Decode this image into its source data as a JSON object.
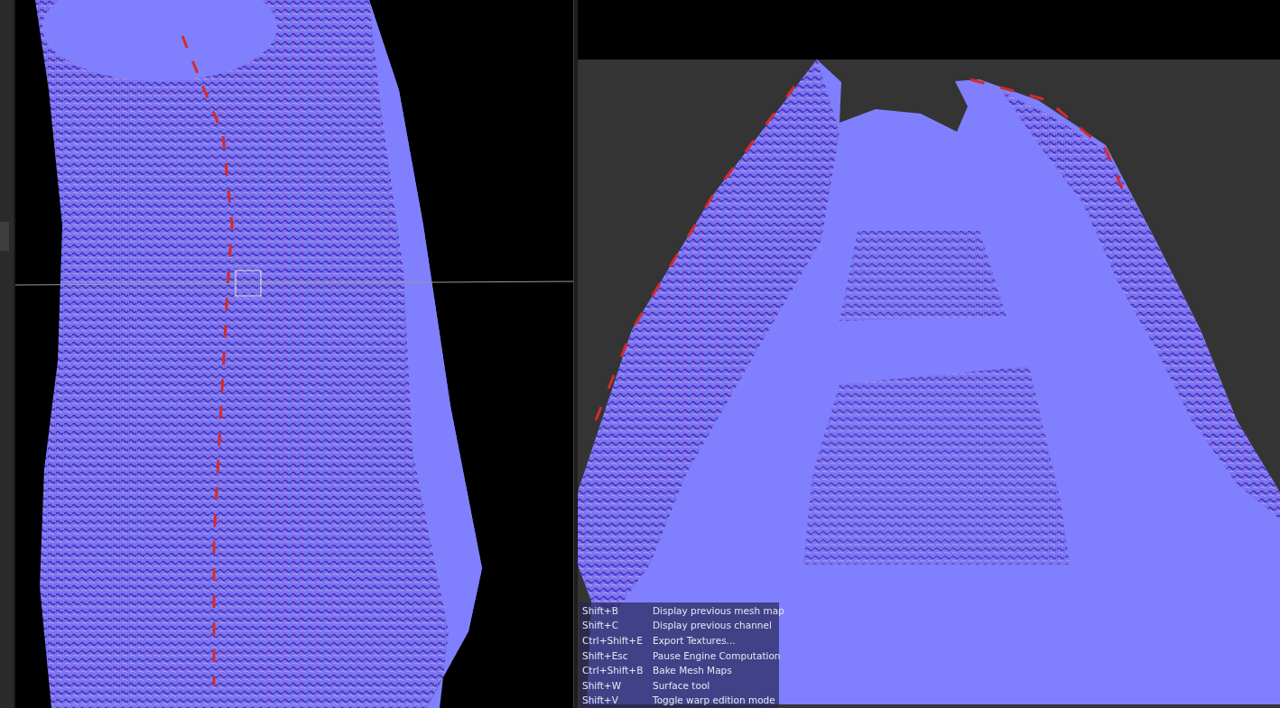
{
  "shortcut_overlay": {
    "shortcuts": [
      {
        "keys": "Shift+B",
        "action": "Display previous mesh map"
      },
      {
        "keys": "Shift+C",
        "action": "Display previous channel"
      },
      {
        "keys": "Ctrl+Shift+E",
        "action": "Export Textures..."
      },
      {
        "keys": "Shift+Esc",
        "action": "Pause Engine Computation"
      },
      {
        "keys": "Ctrl+Shift+B",
        "action": "Bake Mesh Maps"
      },
      {
        "keys": "Shift+W",
        "action": "Surface tool"
      },
      {
        "keys": "Shift+V",
        "action": "Toggle warp edition mode"
      }
    ]
  }
}
